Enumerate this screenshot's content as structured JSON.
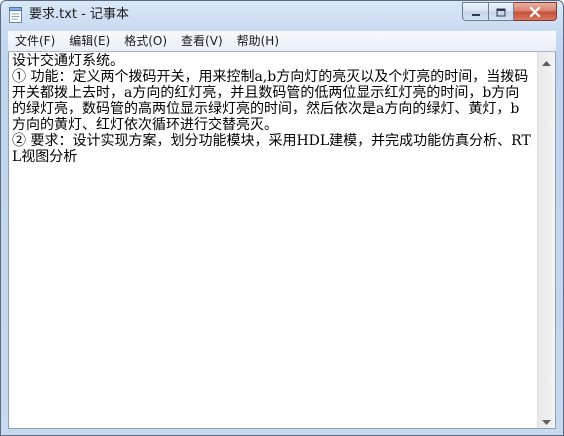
{
  "window": {
    "title": "要求.txt - 记事本"
  },
  "menu": [
    {
      "label": "文件(F)"
    },
    {
      "label": "编辑(E)"
    },
    {
      "label": "格式(O)"
    },
    {
      "label": "查看(V)"
    },
    {
      "label": "帮助(H)"
    }
  ],
  "document": {
    "lines": [
      "设计交通灯系统。",
      "① 功能：定义两个拨码开关，用来控制a,b方向灯的亮灭以及个灯亮的时间，当拨码开关都拨上去时，a方向的红灯亮，并且数码管的低两位显示红灯亮的时间，b方向的绿灯亮，数码管的高两位显示绿灯亮的时间，然后依次是a方向的绿灯、黄灯，b方向的黄灯、红灯依次循环进行交替亮灭。",
      "② 要求：设计实现方案，划分功能模块，采用HDL建模，并完成功能仿真分析、RTL视图分析"
    ]
  },
  "icons": {
    "app": "notepad-icon",
    "minimize": "minimize-icon",
    "maximize": "maximize-icon",
    "close": "close-icon",
    "scroll_up": "scroll-up-arrow-icon",
    "scroll_down": "scroll-down-arrow-icon"
  }
}
